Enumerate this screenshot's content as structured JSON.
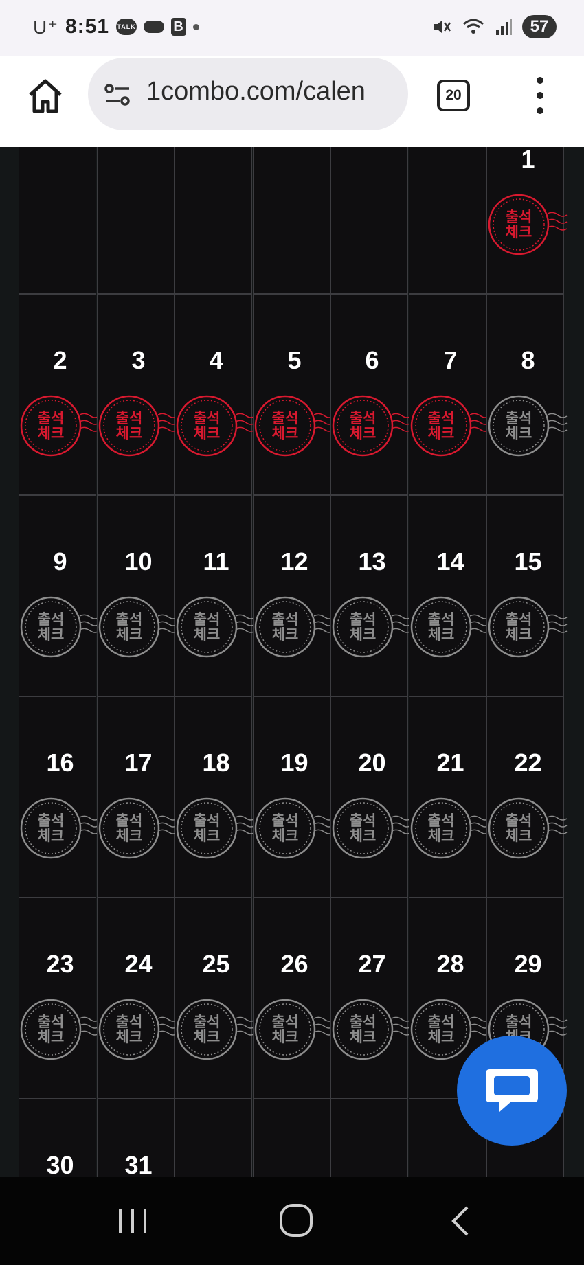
{
  "status_bar": {
    "carrier": "U⁺",
    "time": "8:51",
    "talk_badge": "TALK",
    "b_badge": "B",
    "battery": "57"
  },
  "browser": {
    "url": "1combo.com/calen",
    "tab_count": "20"
  },
  "calendar": {
    "stamp_label_top": "출석",
    "stamp_label_bottom": "체크",
    "checked_color": "#d8192f",
    "unchecked_color": "#8d8d8d",
    "weeks": [
      [
        {
          "day": "",
          "checked": false,
          "stamp": false
        },
        {
          "day": "",
          "checked": false,
          "stamp": false
        },
        {
          "day": "",
          "checked": false,
          "stamp": false
        },
        {
          "day": "",
          "checked": false,
          "stamp": false
        },
        {
          "day": "",
          "checked": false,
          "stamp": false
        },
        {
          "day": "",
          "checked": false,
          "stamp": false
        },
        {
          "day": "1",
          "checked": true,
          "stamp": true
        }
      ],
      [
        {
          "day": "2",
          "checked": true,
          "stamp": true
        },
        {
          "day": "3",
          "checked": true,
          "stamp": true
        },
        {
          "day": "4",
          "checked": true,
          "stamp": true
        },
        {
          "day": "5",
          "checked": true,
          "stamp": true
        },
        {
          "day": "6",
          "checked": true,
          "stamp": true
        },
        {
          "day": "7",
          "checked": true,
          "stamp": true
        },
        {
          "day": "8",
          "checked": false,
          "stamp": true
        }
      ],
      [
        {
          "day": "9",
          "checked": false,
          "stamp": true
        },
        {
          "day": "10",
          "checked": false,
          "stamp": true
        },
        {
          "day": "11",
          "checked": false,
          "stamp": true
        },
        {
          "day": "12",
          "checked": false,
          "stamp": true
        },
        {
          "day": "13",
          "checked": false,
          "stamp": true
        },
        {
          "day": "14",
          "checked": false,
          "stamp": true
        },
        {
          "day": "15",
          "checked": false,
          "stamp": true
        }
      ],
      [
        {
          "day": "16",
          "checked": false,
          "stamp": true
        },
        {
          "day": "17",
          "checked": false,
          "stamp": true
        },
        {
          "day": "18",
          "checked": false,
          "stamp": true
        },
        {
          "day": "19",
          "checked": false,
          "stamp": true
        },
        {
          "day": "20",
          "checked": false,
          "stamp": true
        },
        {
          "day": "21",
          "checked": false,
          "stamp": true
        },
        {
          "day": "22",
          "checked": false,
          "stamp": true
        }
      ],
      [
        {
          "day": "23",
          "checked": false,
          "stamp": true
        },
        {
          "day": "24",
          "checked": false,
          "stamp": true
        },
        {
          "day": "25",
          "checked": false,
          "stamp": true
        },
        {
          "day": "26",
          "checked": false,
          "stamp": true
        },
        {
          "day": "27",
          "checked": false,
          "stamp": true
        },
        {
          "day": "28",
          "checked": false,
          "stamp": true
        },
        {
          "day": "29",
          "checked": false,
          "stamp": true
        }
      ],
      [
        {
          "day": "30",
          "checked": false,
          "stamp": true
        },
        {
          "day": "31",
          "checked": false,
          "stamp": true
        },
        {
          "day": "",
          "checked": false,
          "stamp": false
        },
        {
          "day": "",
          "checked": false,
          "stamp": false
        },
        {
          "day": "",
          "checked": false,
          "stamp": false
        },
        {
          "day": "",
          "checked": false,
          "stamp": false
        },
        {
          "day": "",
          "checked": false,
          "stamp": false
        }
      ]
    ]
  },
  "chat_button": {
    "icon": "chat-bubble-icon",
    "color": "#1f6fe0"
  },
  "nav_bar": {
    "recent": "recent-apps-icon",
    "home": "home-circle-icon",
    "back": "back-chevron-icon"
  }
}
